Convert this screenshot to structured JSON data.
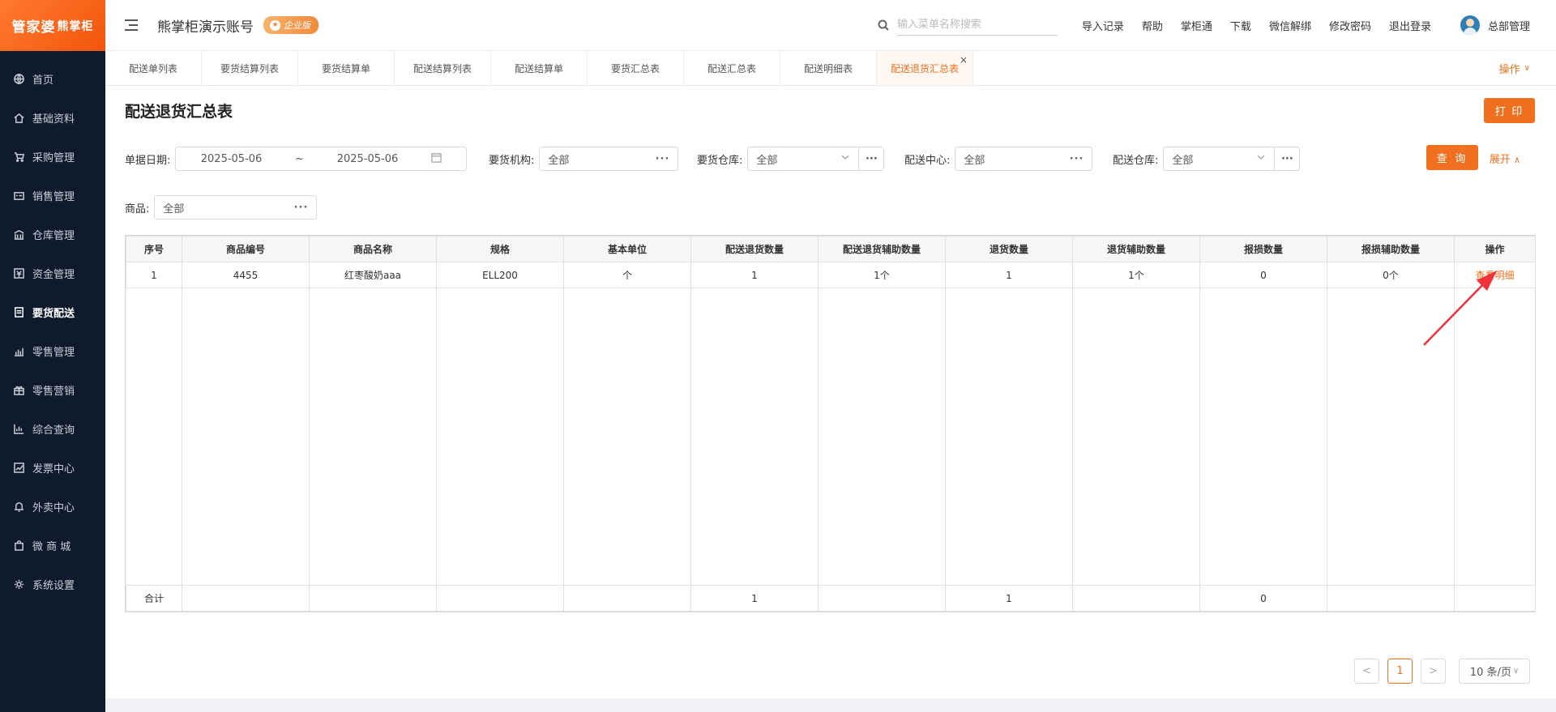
{
  "logo": {
    "main": "管家婆",
    "sub": "熊掌柜"
  },
  "sidebar": {
    "items": [
      {
        "label": "首页",
        "icon": "globe-icon"
      },
      {
        "label": "基础资料",
        "icon": "home-icon"
      },
      {
        "label": "采购管理",
        "icon": "cart-icon"
      },
      {
        "label": "销售管理",
        "icon": "sales-icon"
      },
      {
        "label": "仓库管理",
        "icon": "warehouse-icon"
      },
      {
        "label": "资金管理",
        "icon": "money-icon"
      },
      {
        "label": "要货配送",
        "icon": "document-icon",
        "active": true
      },
      {
        "label": "零售管理",
        "icon": "bar-chart-icon"
      },
      {
        "label": "零售营销",
        "icon": "gift-icon"
      },
      {
        "label": "综合查询",
        "icon": "stats-icon"
      },
      {
        "label": "发票中心",
        "icon": "trend-icon"
      },
      {
        "label": "外卖中心",
        "icon": "bell-icon"
      },
      {
        "label": "微 商 城",
        "icon": "bag-icon"
      },
      {
        "label": "系统设置",
        "icon": "gear-icon"
      }
    ]
  },
  "header": {
    "account_title": "熊掌柜演示账号",
    "edition_badge": "企业版",
    "search_placeholder": "输入菜单名称搜索",
    "links": [
      "导入记录",
      "帮助",
      "掌柜通",
      "下载",
      "微信解绑",
      "修改密码",
      "退出登录"
    ],
    "user_name": "总部管理"
  },
  "tabs": {
    "items": [
      "配送单列表",
      "要货结算列表",
      "要货结算单",
      "配送结算列表",
      "配送结算单",
      "要货汇总表",
      "配送汇总表",
      "配送明细表",
      "配送退货汇总表"
    ],
    "active_index": 8,
    "close_symbol": "×",
    "operations_label": "操作"
  },
  "page": {
    "title": "配送退货汇总表",
    "print_label": "打 印",
    "query_label": "查 询",
    "expand_label": "展开"
  },
  "filters": {
    "date_label": "单据日期:",
    "date_start": "2025-05-06",
    "date_sep": "~",
    "date_end": "2025-05-06",
    "org_label": "要货机构:",
    "org_value": "全部",
    "req_wh_label": "要货仓库:",
    "req_wh_value": "全部",
    "center_label": "配送中心:",
    "center_value": "全部",
    "dist_wh_label": "配送仓库:",
    "dist_wh_value": "全部",
    "product_label": "商品:",
    "product_value": "全部",
    "dots": "···"
  },
  "table": {
    "headers": [
      "序号",
      "商品编号",
      "商品名称",
      "规格",
      "基本单位",
      "配送退货数量",
      "配送退货辅助数量",
      "退货数量",
      "退货辅助数量",
      "报损数量",
      "报损辅助数量",
      "操作"
    ],
    "rows": [
      [
        "1",
        "4455",
        "红枣酸奶aaa",
        "ELL200",
        "个",
        "1",
        "1个",
        "1",
        "1个",
        "0",
        "0个",
        "查看明细"
      ]
    ],
    "footer": [
      "合计",
      "",
      "",
      "",
      "",
      "1",
      "",
      "1",
      "",
      "0",
      "",
      ""
    ]
  },
  "pagination": {
    "prev": "<",
    "current": "1",
    "next": ">",
    "page_size": "10 条/页"
  },
  "colors": {
    "accent": "#f07020",
    "sidebar_bg": "#0f1b2d",
    "arrow": "#f0303a"
  }
}
